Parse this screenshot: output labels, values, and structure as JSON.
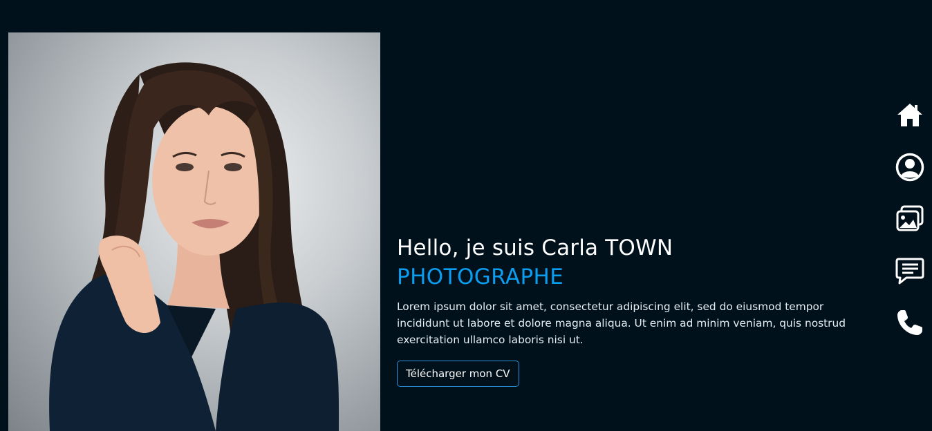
{
  "hero": {
    "greeting": "Hello, je suis Carla TOWN",
    "role": "PHOTOGRAPHE",
    "bio": "Lorem ipsum dolor sit amet, consectetur adipiscing elit, sed do eiusmod tempor incididunt ut labore et dolore magna aliqua. Ut enim ad minim veniam, quis nostrud exercitation ullamco laboris nisi ut.",
    "cv_button_label": "Télécharger mon CV"
  },
  "portrait": {
    "alt": "Portrait de Carla Town"
  },
  "side_nav": {
    "items": [
      {
        "icon": "home-icon"
      },
      {
        "icon": "user-circle-icon"
      },
      {
        "icon": "images-icon"
      },
      {
        "icon": "message-icon"
      },
      {
        "icon": "phone-icon"
      }
    ]
  },
  "colors": {
    "background": "#00111c",
    "accent": "#0a9df0",
    "text": "#ffffff"
  }
}
